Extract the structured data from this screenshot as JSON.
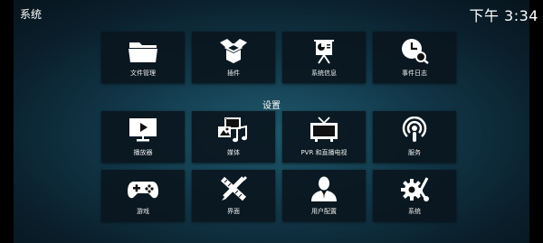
{
  "header": {
    "title": "系统",
    "clock": "下午 3:34"
  },
  "top_row": [
    {
      "label": "文件管理",
      "icon": "folder-icon"
    },
    {
      "label": "插件",
      "icon": "open-box-icon"
    },
    {
      "label": "系统信息",
      "icon": "presentation-icon"
    },
    {
      "label": "事件日志",
      "icon": "clock-search-icon"
    }
  ],
  "section_title": "设置",
  "settings": [
    {
      "label": "播放器",
      "icon": "monitor-play-icon"
    },
    {
      "label": "媒体",
      "icon": "media-icon"
    },
    {
      "label": "PVR 和直播电视",
      "icon": "tv-icon"
    },
    {
      "label": "服务",
      "icon": "podcast-icon"
    },
    {
      "label": "游戏",
      "icon": "gamepad-icon"
    },
    {
      "label": "界面",
      "icon": "pencil-ruler-icon"
    },
    {
      "label": "用户配置",
      "icon": "user-icon"
    },
    {
      "label": "系统",
      "icon": "gears-icon"
    }
  ]
}
